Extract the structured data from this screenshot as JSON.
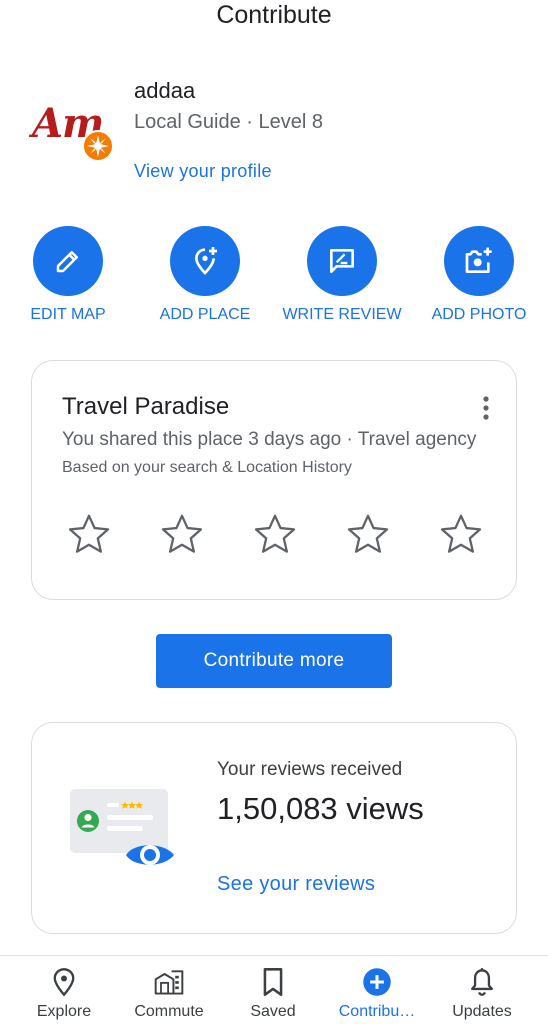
{
  "header": {
    "title": "Contribute"
  },
  "profile": {
    "avatar_text": "Am",
    "name": "addaa",
    "level": "Local Guide · Level 8",
    "link": "View your profile"
  },
  "actions": [
    {
      "label": "EDIT MAP",
      "icon": "pencil-icon"
    },
    {
      "label": "ADD PLACE",
      "icon": "add-place-icon"
    },
    {
      "label": "WRITE REVIEW",
      "icon": "write-review-icon"
    },
    {
      "label": "ADD PHOTO",
      "icon": "add-photo-icon"
    }
  ],
  "place_card": {
    "title": "Travel Paradise",
    "subtitle": "You shared this place 3 days ago · Travel agency",
    "note": "Based on your search & Location History",
    "rating": 0,
    "max_rating": 5
  },
  "contribute_more": "Contribute more",
  "reviews_card": {
    "label": "Your reviews received",
    "views": "1,50,083 views",
    "link": "See your reviews"
  },
  "bottom_nav": [
    {
      "label": "Explore",
      "icon": "location-pin-icon",
      "active": false
    },
    {
      "label": "Commute",
      "icon": "commute-icon",
      "active": false
    },
    {
      "label": "Saved",
      "icon": "bookmark-icon",
      "active": false
    },
    {
      "label": "Contribu…",
      "icon": "add-circle-icon",
      "active": true
    },
    {
      "label": "Updates",
      "icon": "bell-icon",
      "active": false
    }
  ],
  "colors": {
    "accent": "#1a73e8",
    "text": "#202124",
    "secondary": "#5f6368"
  }
}
